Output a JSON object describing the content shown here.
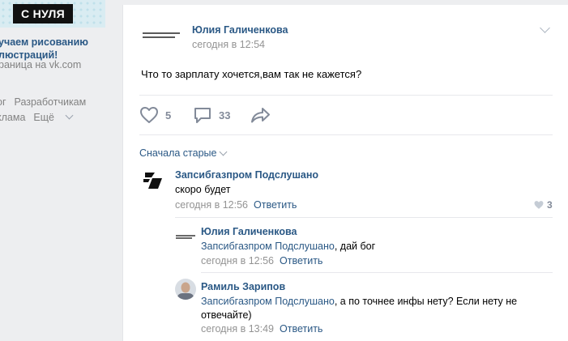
{
  "sidebar": {
    "ad_badge": "С НУЛЯ",
    "ad_title_line1": "учаем рисованию",
    "ad_title_line2": "люстраций!",
    "ad_subtitle": "раница на vk.com",
    "links_row1": [
      "ог",
      "Разработчикам"
    ],
    "links_row2": [
      "клама",
      "Ещё"
    ]
  },
  "post": {
    "author": "Юлия Галиченкова",
    "time": "сегодня в 12:54",
    "text": "Что то зарплату хочется,вам так не кажется?",
    "likes": "5",
    "comments": "33"
  },
  "comments": {
    "sort_label": "Сначала старые",
    "items": [
      {
        "author": "Запсибгазпром Подслушано",
        "text": "скоро будет",
        "time": "сегодня в 12:56",
        "reply_label": "Ответить",
        "likes": "3"
      },
      {
        "author": "Юлия Галиченкова",
        "mention": "Запсибгазпром Подслушано",
        "text": ", дай бог",
        "time": "сегодня в 12:56",
        "reply_label": "Ответить"
      },
      {
        "author": "Рамиль Зарипов",
        "mention": "Запсибгазпром Подслушано",
        "text_line1": ", а по точнее инфы нету? Если нету не",
        "text_line2": "отвечайте)",
        "time": "сегодня в 13:49",
        "reply_label": "Ответить"
      }
    ]
  },
  "colors": {
    "link": "#2a5885",
    "secondary": "#939393",
    "page_bg": "#edeef0",
    "icon": "#828a99"
  },
  "icons": [
    "heart-icon",
    "comment-icon",
    "share-icon",
    "chevron-down-icon"
  ]
}
